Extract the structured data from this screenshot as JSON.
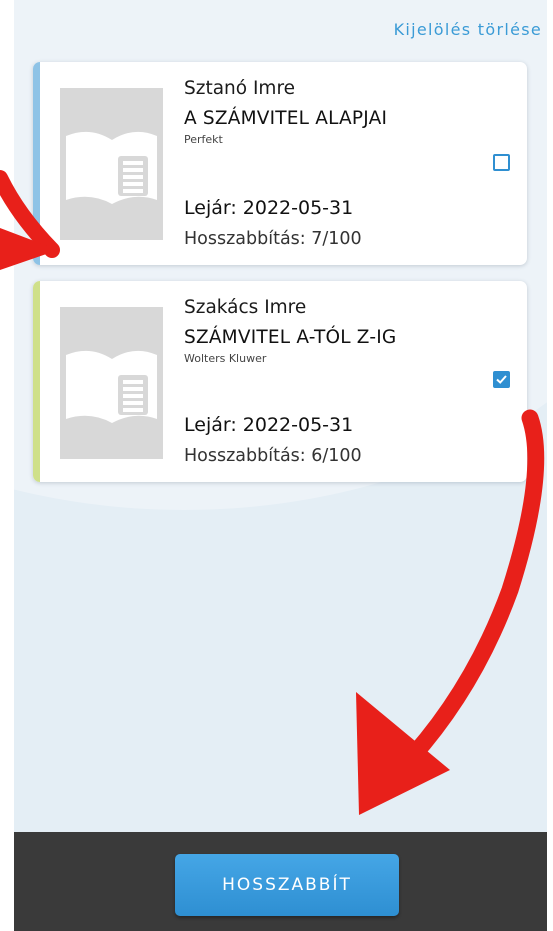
{
  "header": {
    "clear_selection_label": "Kijelölés törlése"
  },
  "items": [
    {
      "author": "Sztanó Imre",
      "title": "A SZÁMVITEL ALAPJAI",
      "publisher": "Perfekt",
      "due": "Lejár: 2022-05-31",
      "renewals": "Hosszabbítás: 7/100",
      "selected": false,
      "accent_color": "#8ec3e6"
    },
    {
      "author": "Szakács Imre",
      "title": "SZÁMVITEL A-TÓL Z-IG",
      "publisher": "Wolters Kluwer",
      "due": "Lejár: 2022-05-31",
      "renewals": "Hosszabbítás: 6/100",
      "selected": true,
      "accent_color": "#cfe08a"
    }
  ],
  "footer": {
    "renew_button_label": "HOSSZABBÍT"
  },
  "colors": {
    "primary": "#2f8fd1",
    "annotation_arrow": "#e8201a",
    "bottom_bar": "#3a3a3a"
  },
  "icons": {
    "cover_placeholder": "open-book-icon",
    "checkbox_checked": "check-icon"
  }
}
